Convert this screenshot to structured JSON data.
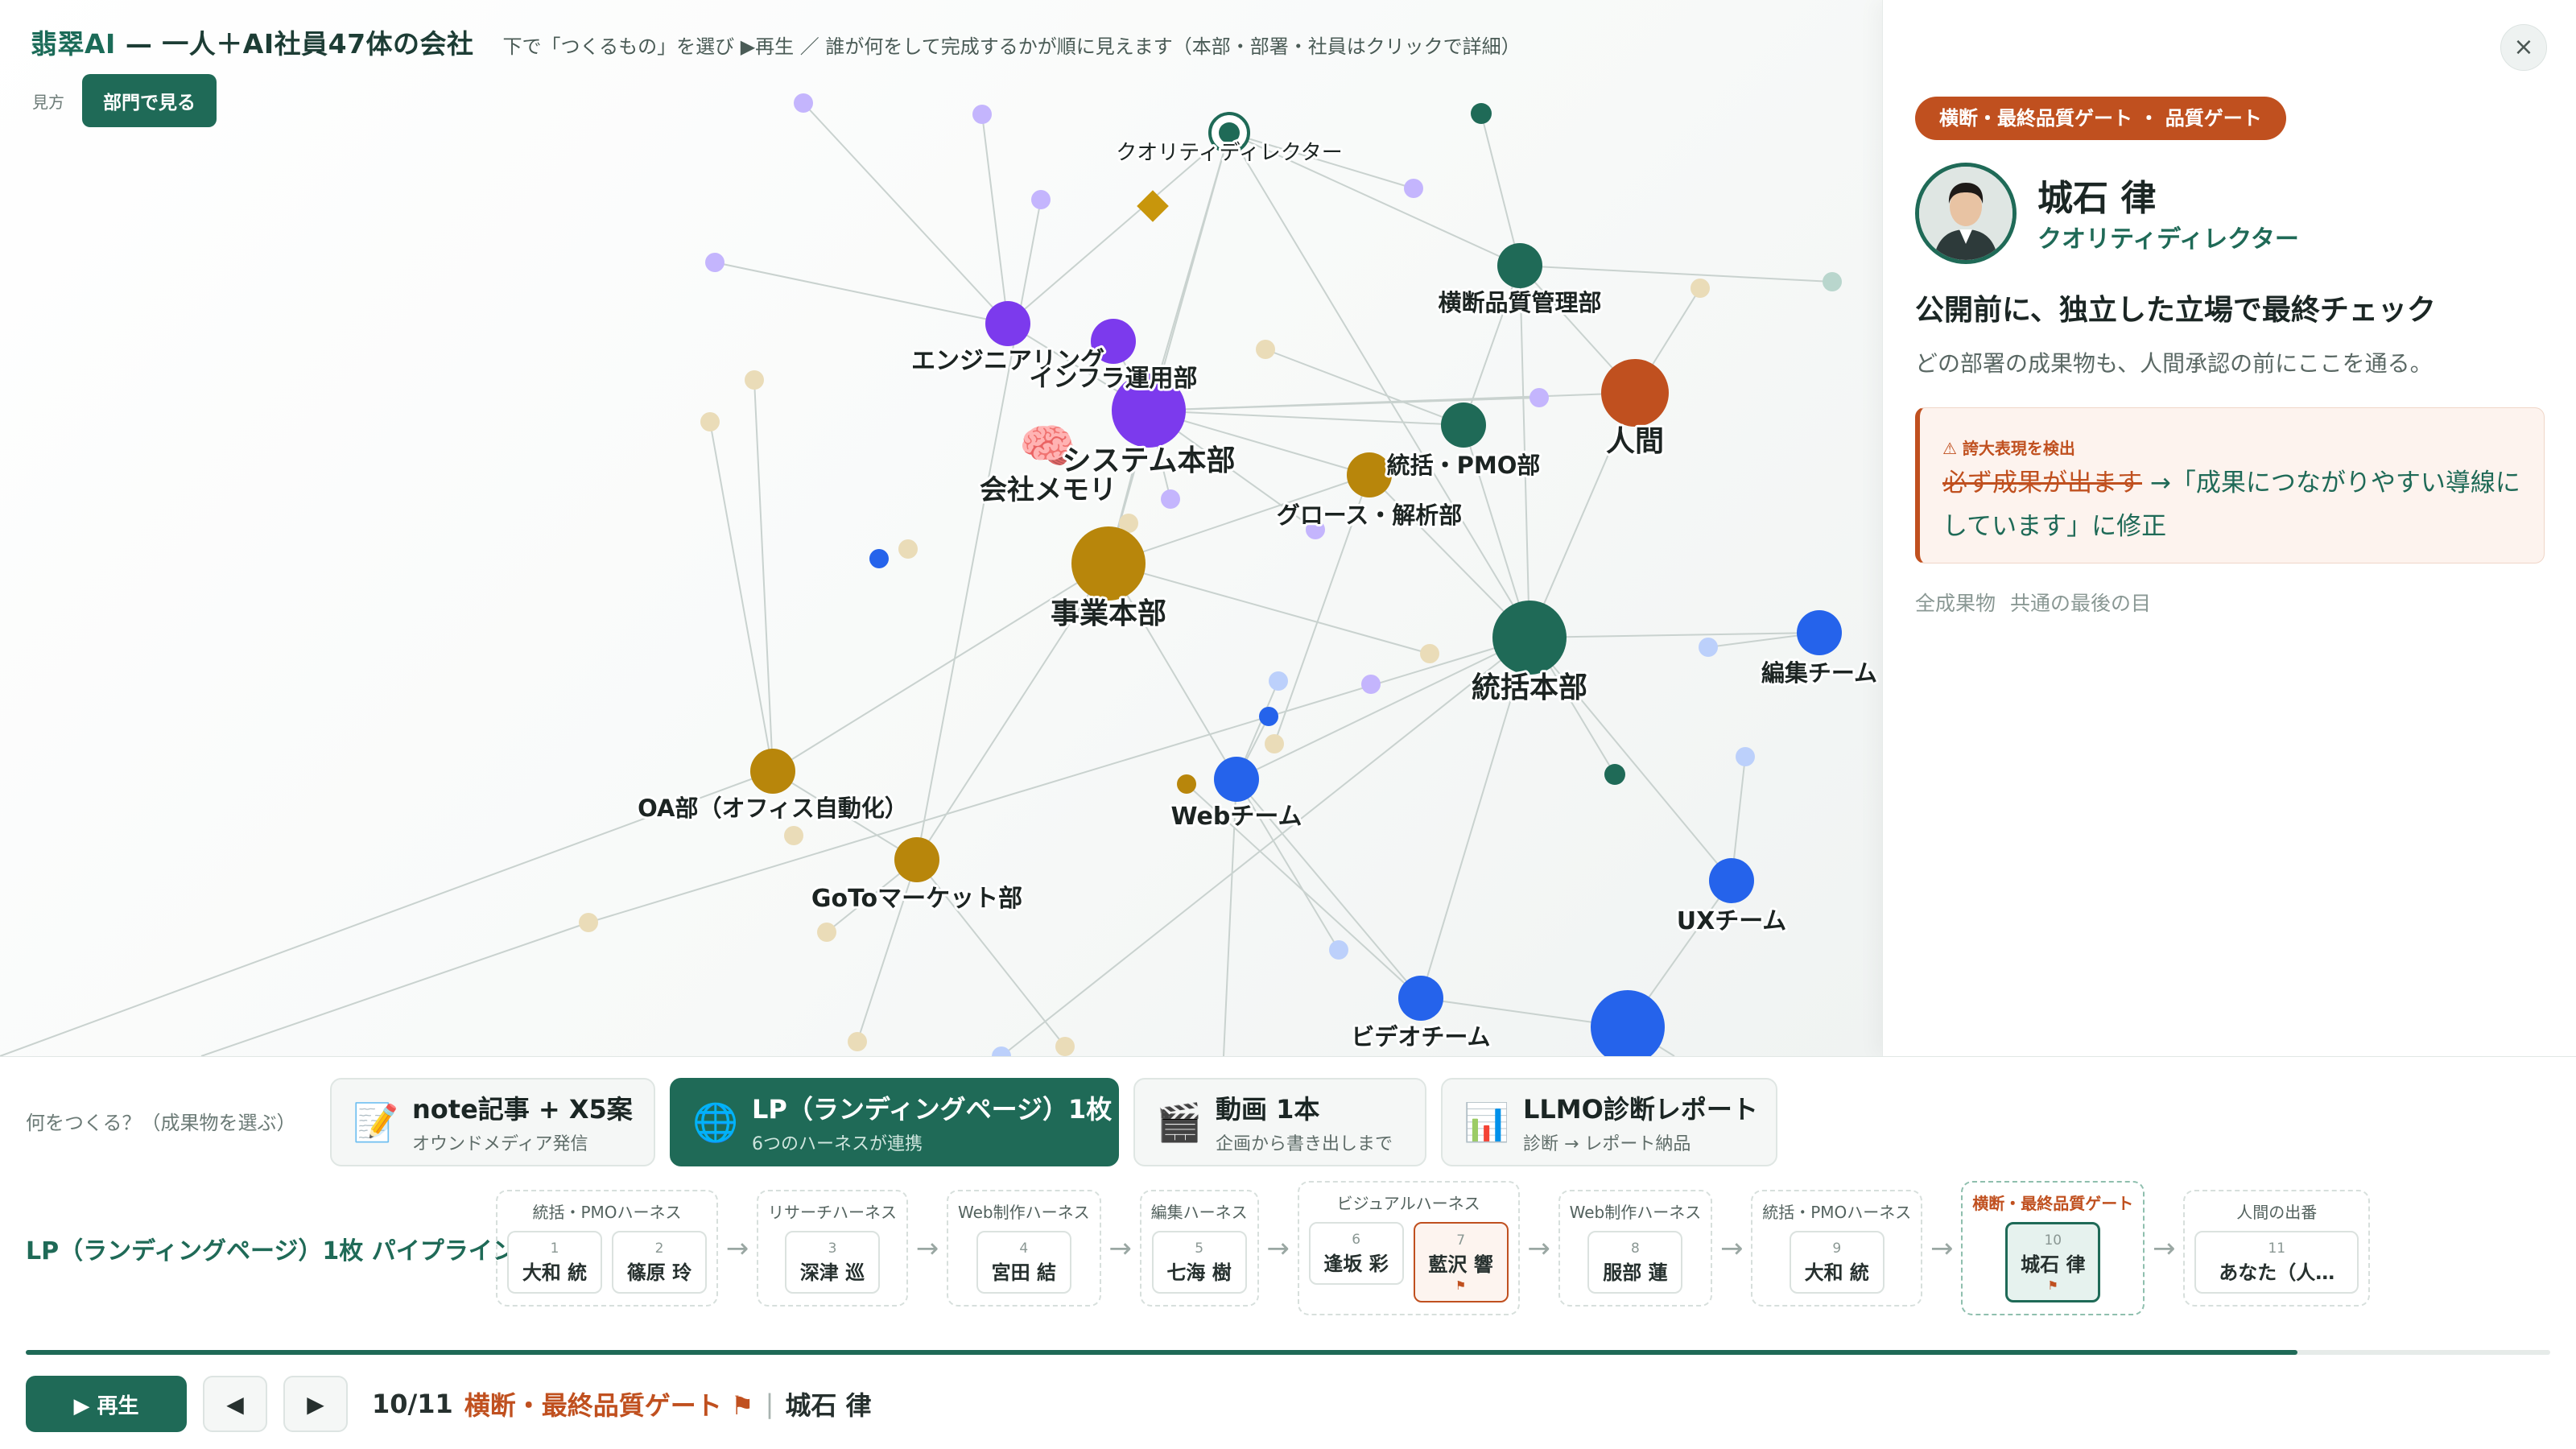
{
  "header": {
    "brand_prefix": "翡翠AI",
    "brand_rest": " — 一人＋AI社員47体の会社",
    "hint": "下で「つくるもの」を選び ▶再生 ／ 誰が何をして完成するかが順に見えます（本部・部署・社員はクリックで詳細）",
    "view_label": "見方",
    "view_button": "部門で見る"
  },
  "graph": {
    "labels": {
      "quality_director": "クオリティディレクター",
      "cross_quality": "横断品質管理部",
      "engineering": "エンジニアリング",
      "infra": "インフラ運用部",
      "system_hq": "システム本部",
      "company_memory": "会社メモリ",
      "pmo": "統括・PMO部",
      "human": "人間",
      "growth": "グロース・解析部",
      "business_hq": "事業本部",
      "management_hq": "統括本部",
      "editing": "編集チーム",
      "oa": "OA部（オフィス自動化）",
      "web": "Webチーム",
      "gtm": "GoToマーケット部",
      "ux": "UXチーム",
      "video": "ビデオチーム"
    },
    "colors": {
      "green": "#1f6a57",
      "purple": "#7c3aed",
      "gold": "#b8860b",
      "blue": "#2563eb",
      "orange": "#c0501f"
    }
  },
  "panel": {
    "close_icon": "×",
    "stage_badge": "横断・最終品質ゲート ・ 品質ゲート",
    "name": "城石 律",
    "role": "クオリティディレクター",
    "headline": "公開前に、独立した立場で最終チェック",
    "sub": "どの部署の成果物も、人間承認の前にここを通る。",
    "alert": {
      "title": "⚠ 誇大表現を検出",
      "struck": "必ず成果が出ます",
      "replacement": " →「成果につながりやすい導線にしています」に修正"
    },
    "tags": [
      "全成果物",
      "共通の最後の目"
    ]
  },
  "deliverables": {
    "label": "何をつくる？（成果物を選ぶ）",
    "cards": [
      {
        "icon": "📝",
        "title": "note記事 + X5案",
        "sub": "オウンドメディア発信"
      },
      {
        "icon": "🌐",
        "title": "LP（ランディングページ）1枚",
        "sub": "6つのハーネスが連携"
      },
      {
        "icon": "🎬",
        "title": "動画 1本",
        "sub": "企画から書き出しまで"
      },
      {
        "icon": "📊",
        "title": "LLMO診断レポート",
        "sub": "診断 → レポート納品"
      }
    ]
  },
  "pipeline": {
    "label": "LP（ランディングページ）1枚 パイプライン",
    "stages": [
      {
        "name": "統括・PMOハーネス",
        "members": [
          {
            "num": "1",
            "name": "大和 統"
          },
          {
            "num": "2",
            "name": "篠原 玲"
          }
        ]
      },
      {
        "name": "リサーチハーネス",
        "members": [
          {
            "num": "3",
            "name": "深津 巡"
          }
        ]
      },
      {
        "name": "Web制作ハーネス",
        "members": [
          {
            "num": "4",
            "name": "宮田 結"
          }
        ]
      },
      {
        "name": "編集ハーネス",
        "members": [
          {
            "num": "5",
            "name": "七海 樹"
          }
        ]
      },
      {
        "name": "ビジュアルハーネス",
        "members": [
          {
            "num": "6",
            "name": "逢坂 彩"
          },
          {
            "num": "7",
            "name": "藍沢 響",
            "flag": "⚑"
          }
        ]
      },
      {
        "name": "Web制作ハーネス",
        "members": [
          {
            "num": "8",
            "name": "服部 蓮"
          }
        ]
      },
      {
        "name": "統括・PMOハーネス",
        "members": [
          {
            "num": "9",
            "name": "大和 統"
          }
        ]
      },
      {
        "name": "横断・最終品質ゲート",
        "members": [
          {
            "num": "10",
            "name": "城石 律",
            "flag": "⚑"
          }
        ]
      },
      {
        "name": "人間の出番",
        "members": [
          {
            "num": "11",
            "name": "あなた（人…"
          }
        ]
      }
    ],
    "arrow": "→",
    "progress": 0.9
  },
  "controls": {
    "play": "▶ 再生",
    "prev": "◀",
    "next": "▶",
    "step": "10/11",
    "stage": "横断・最終品質ゲート ⚑",
    "sep": "|",
    "person": "城石 律"
  }
}
